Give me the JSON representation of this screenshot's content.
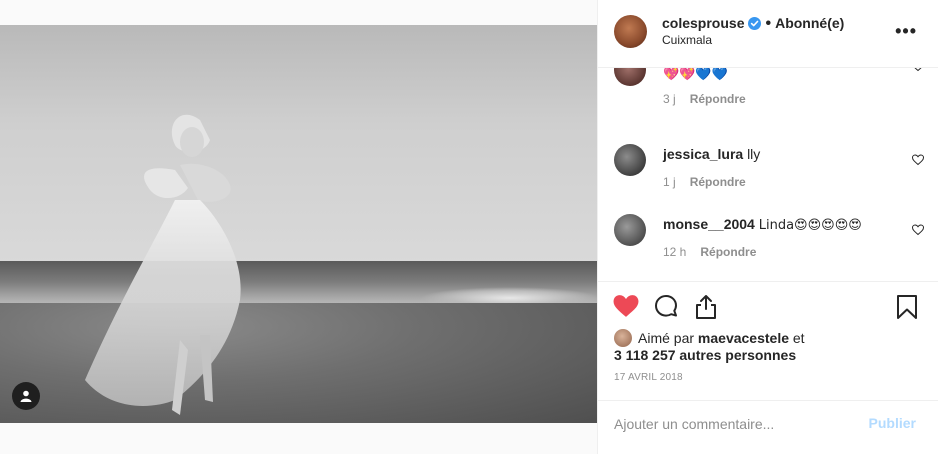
{
  "post": {
    "username": "colesprouse",
    "verified": true,
    "separator": "•",
    "follow_status": "Abonné(e)",
    "location": "Cuixmala",
    "more_icon": "more-options-icon"
  },
  "comments": [
    {
      "username": "",
      "text": "💖💖💙💙",
      "time": "3 j",
      "reply": "Répondre"
    },
    {
      "username": "jessica_lura",
      "text": "lly",
      "time": "1 j",
      "reply": "Répondre"
    },
    {
      "username": "monse__2004",
      "text": "Linda😍😍😍😍😍",
      "time": "12 h",
      "reply": "Répondre"
    }
  ],
  "actions": {
    "like_icon": "heart-filled-icon",
    "comment_icon": "comment-icon",
    "share_icon": "share-icon",
    "save_icon": "bookmark-icon",
    "liked": true
  },
  "likes": {
    "prefix": "Aimé par",
    "liked_by": "maevacestele",
    "conjunction": "et",
    "others": "3 118 257 autres personnes"
  },
  "date": "17 AVRIL 2018",
  "comment_box": {
    "placeholder": "Ajouter un commentaire...",
    "post_label": "Publier"
  },
  "colors": {
    "like_red": "#ed4956",
    "verified_blue": "#3897f0",
    "post_disabled": "#b3dbff",
    "muted": "#8e8e8e"
  }
}
